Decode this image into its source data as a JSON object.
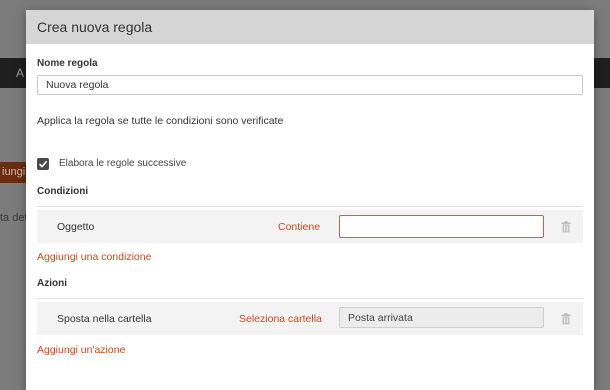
{
  "background": {
    "topbar_text": "A",
    "orange_button_text": "iungi u",
    "side_text": "ta det"
  },
  "dialog": {
    "title": "Crea nuova regola",
    "rule_name_label": "Nome regola",
    "rule_name_value": "Nuova regola",
    "apply_text": "Applica la regola se tutte le condizioni sono verificate",
    "process_next_label": "Elabora le regole successive",
    "process_next_checked": true
  },
  "conditions": {
    "title": "Condizioni",
    "rows": [
      {
        "field": "Oggetto",
        "operator": "Contiene",
        "value": ""
      }
    ],
    "add_link": "Aggiungi una condizione"
  },
  "actions": {
    "title": "Azioni",
    "rows": [
      {
        "action": "Sposta nella cartella",
        "selector": "Seleziona cartella",
        "folder": "Posta arrivata"
      }
    ],
    "add_link": "Aggiungi un'azione"
  },
  "colors": {
    "accent": "#d0461a",
    "header_bg": "#d6d6d6",
    "overlay": "#7c7c7c"
  },
  "icons": {
    "checkbox": "checkmark-icon",
    "delete": "trash-icon"
  }
}
